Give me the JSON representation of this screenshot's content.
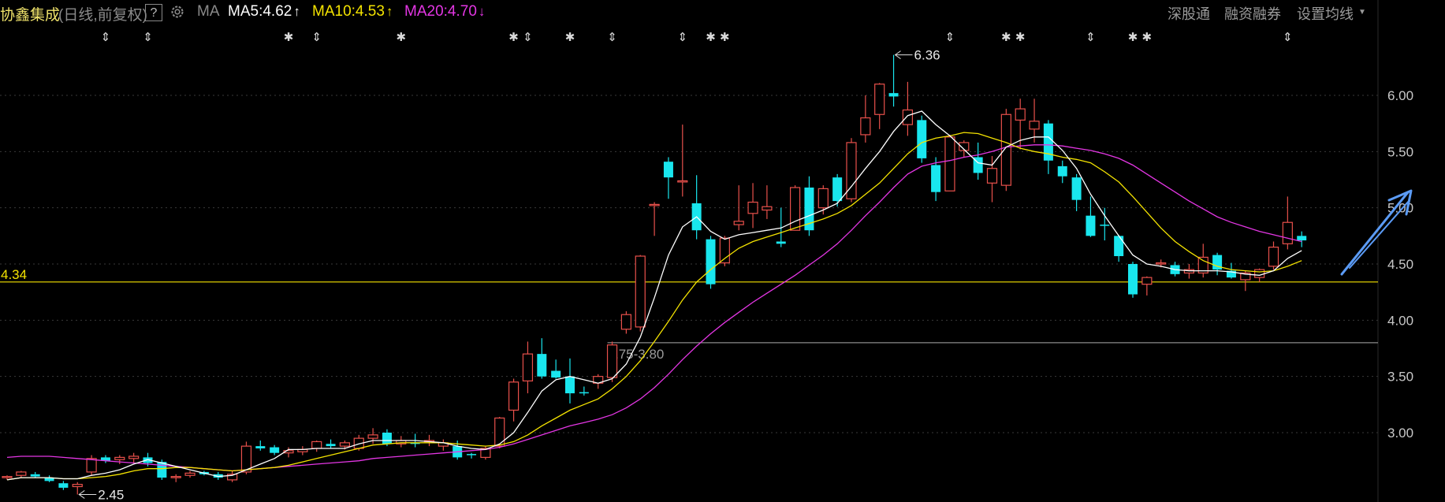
{
  "header": {
    "stock_name": "协鑫集成",
    "adj_mode": "(日线,前复权)",
    "help": "?",
    "ma_label": "MA",
    "ma5": "MA5:4.62",
    "ma10": "MA10:4.53",
    "ma20": "MA20:4.70",
    "up_arrow": "↑",
    "down_arrow": "↓",
    "nav": [
      "深股通",
      "融资融券",
      "设置均线"
    ],
    "caret": "▼"
  },
  "icons": {
    "settings": "gear-icon",
    "dropdown": "chevron-down-icon",
    "trend": "trend-arrow-icon",
    "event": "event-marker-icon"
  },
  "colors": {
    "up": "#e8504b",
    "down": "#19e6ee",
    "ma5": "#ffffff",
    "ma10": "#f4e300",
    "ma20": "#e436e4",
    "hline": "#f4e300",
    "range_line": "#8a8a8a",
    "trend_arrow": "#5b9bf5",
    "bg": "#000000"
  },
  "chart_data": {
    "type": "candlestick",
    "ylim": [
      2.4,
      6.7
    ],
    "y_ticks": [
      "6.00",
      "5.50",
      "5.00",
      "4.50",
      "4.00",
      "3.50",
      "3.00"
    ],
    "y_tick_values": [
      6.0,
      5.5,
      5.0,
      4.5,
      4.0,
      3.5,
      3.0
    ],
    "grid": true,
    "candles": [
      [
        2.6,
        2.62,
        2.58,
        2.61
      ],
      [
        2.62,
        2.66,
        2.6,
        2.65
      ],
      [
        2.63,
        2.65,
        2.6,
        2.61
      ],
      [
        2.6,
        2.62,
        2.56,
        2.57
      ],
      [
        2.55,
        2.57,
        2.49,
        2.51
      ],
      [
        2.52,
        2.56,
        2.45,
        2.54
      ],
      [
        2.65,
        2.8,
        2.62,
        2.77
      ],
      [
        2.78,
        2.8,
        2.73,
        2.75
      ],
      [
        2.76,
        2.8,
        2.72,
        2.78
      ],
      [
        2.77,
        2.82,
        2.73,
        2.79
      ],
      [
        2.78,
        2.82,
        2.7,
        2.73
      ],
      [
        2.74,
        2.76,
        2.58,
        2.6
      ],
      [
        2.6,
        2.63,
        2.56,
        2.61
      ],
      [
        2.62,
        2.66,
        2.6,
        2.64
      ],
      [
        2.65,
        2.66,
        2.62,
        2.63
      ],
      [
        2.63,
        2.65,
        2.58,
        2.6
      ],
      [
        2.58,
        2.66,
        2.56,
        2.63
      ],
      [
        2.65,
        2.92,
        2.63,
        2.88
      ],
      [
        2.88,
        2.93,
        2.84,
        2.86
      ],
      [
        2.87,
        2.89,
        2.8,
        2.82
      ],
      [
        2.82,
        2.87,
        2.78,
        2.84
      ],
      [
        2.83,
        2.88,
        2.8,
        2.85
      ],
      [
        2.86,
        2.93,
        2.83,
        2.92
      ],
      [
        2.9,
        2.94,
        2.86,
        2.88
      ],
      [
        2.88,
        2.93,
        2.85,
        2.91
      ],
      [
        2.86,
        2.98,
        2.84,
        2.95
      ],
      [
        2.95,
        3.04,
        2.9,
        2.98
      ],
      [
        3.0,
        3.03,
        2.88,
        2.9
      ],
      [
        2.9,
        2.97,
        2.87,
        2.93
      ],
      [
        2.91,
        2.99,
        2.87,
        2.9
      ],
      [
        2.92,
        2.98,
        2.88,
        2.93
      ],
      [
        2.88,
        2.94,
        2.84,
        2.91
      ],
      [
        2.88,
        2.93,
        2.76,
        2.78
      ],
      [
        2.81,
        2.82,
        2.77,
        2.8
      ],
      [
        2.78,
        2.88,
        2.76,
        2.86
      ],
      [
        2.88,
        3.14,
        2.86,
        3.13
      ],
      [
        3.2,
        3.48,
        3.1,
        3.45
      ],
      [
        3.46,
        3.81,
        3.35,
        3.7
      ],
      [
        3.7,
        3.84,
        3.48,
        3.5
      ],
      [
        3.55,
        3.65,
        3.48,
        3.49
      ],
      [
        3.5,
        3.66,
        3.26,
        3.35
      ],
      [
        3.36,
        3.41,
        3.33,
        3.35
      ],
      [
        3.44,
        3.52,
        3.39,
        3.5
      ],
      [
        3.49,
        3.81,
        3.45,
        3.78
      ],
      [
        3.92,
        4.08,
        3.88,
        4.05
      ],
      [
        3.94,
        4.58,
        3.9,
        4.57
      ],
      [
        5.02,
        5.05,
        4.75,
        5.03
      ],
      [
        5.41,
        5.45,
        5.08,
        5.27
      ],
      [
        5.24,
        5.74,
        5.1,
        5.24
      ],
      [
        5.04,
        5.29,
        4.72,
        4.8
      ],
      [
        4.72,
        4.75,
        4.28,
        4.32
      ],
      [
        4.51,
        4.75,
        4.48,
        4.73
      ],
      [
        4.85,
        5.2,
        4.8,
        4.88
      ],
      [
        4.95,
        5.22,
        4.82,
        5.05
      ],
      [
        4.98,
        5.2,
        4.9,
        5.01
      ],
      [
        4.7,
        5.0,
        4.65,
        4.68
      ],
      [
        4.8,
        5.2,
        4.8,
        5.18
      ],
      [
        5.18,
        5.28,
        4.75,
        4.8
      ],
      [
        5.0,
        5.2,
        4.94,
        5.17
      ],
      [
        5.27,
        5.3,
        5.01,
        5.06
      ],
      [
        5.08,
        5.62,
        5.05,
        5.58
      ],
      [
        5.65,
        6.0,
        5.58,
        5.8
      ],
      [
        5.83,
        6.11,
        5.7,
        6.1
      ],
      [
        6.02,
        6.36,
        5.9,
        5.99
      ],
      [
        5.74,
        6.12,
        5.64,
        5.87
      ],
      [
        5.78,
        5.82,
        5.4,
        5.44
      ],
      [
        5.38,
        5.45,
        5.06,
        5.14
      ],
      [
        5.15,
        5.65,
        5.15,
        5.63
      ],
      [
        5.51,
        5.6,
        5.45,
        5.58
      ],
      [
        5.45,
        5.58,
        5.25,
        5.31
      ],
      [
        5.22,
        5.46,
        5.05,
        5.35
      ],
      [
        5.2,
        5.88,
        5.15,
        5.83
      ],
      [
        5.78,
        5.97,
        5.52,
        5.88
      ],
      [
        5.7,
        5.97,
        5.58,
        5.77
      ],
      [
        5.75,
        5.78,
        5.3,
        5.42
      ],
      [
        5.37,
        5.42,
        5.22,
        5.28
      ],
      [
        5.27,
        5.3,
        4.97,
        5.07
      ],
      [
        4.93,
        5.1,
        4.74,
        4.75
      ],
      [
        4.85,
        5.0,
        4.71,
        4.84
      ],
      [
        4.75,
        4.76,
        4.52,
        4.57
      ],
      [
        4.5,
        4.52,
        4.2,
        4.23
      ],
      [
        4.32,
        4.39,
        4.22,
        4.38
      ],
      [
        4.5,
        4.54,
        4.47,
        4.51
      ],
      [
        4.49,
        4.52,
        4.39,
        4.41
      ],
      [
        4.42,
        4.5,
        4.37,
        4.45
      ],
      [
        4.42,
        4.68,
        4.38,
        4.56
      ],
      [
        4.58,
        4.6,
        4.4,
        4.45
      ],
      [
        4.44,
        4.51,
        4.37,
        4.38
      ],
      [
        4.36,
        4.44,
        4.26,
        4.42
      ],
      [
        4.38,
        4.46,
        4.34,
        4.45
      ],
      [
        4.48,
        4.7,
        4.45,
        4.65
      ],
      [
        4.68,
        5.1,
        4.63,
        4.87
      ],
      [
        4.75,
        4.79,
        4.65,
        4.71
      ]
    ],
    "ma5": [
      2.58,
      2.6,
      2.6,
      2.6,
      2.59,
      2.59,
      2.62,
      2.64,
      2.67,
      2.72,
      2.76,
      2.73,
      2.7,
      2.67,
      2.64,
      2.61,
      2.62,
      2.67,
      2.72,
      2.77,
      2.85,
      2.85,
      2.86,
      2.86,
      2.86,
      2.9,
      2.93,
      2.93,
      2.93,
      2.93,
      2.92,
      2.91,
      2.88,
      2.86,
      2.85,
      2.9,
      3.0,
      3.18,
      3.37,
      3.47,
      3.5,
      3.47,
      3.44,
      3.48,
      3.61,
      3.85,
      4.2,
      4.58,
      4.83,
      4.92,
      4.79,
      4.72,
      4.76,
      4.78,
      4.8,
      4.82,
      4.88,
      4.93,
      4.98,
      5.04,
      5.19,
      5.35,
      5.5,
      5.68,
      5.82,
      5.86,
      5.74,
      5.64,
      5.52,
      5.4,
      5.38,
      5.54,
      5.6,
      5.63,
      5.63,
      5.51,
      5.35,
      5.12,
      4.93,
      4.75,
      4.58,
      4.5,
      4.48,
      4.45,
      4.44,
      4.44,
      4.44,
      4.43,
      4.41,
      4.4,
      4.44,
      4.55,
      4.62
    ],
    "ma10": [
      2.58,
      2.6,
      2.6,
      2.6,
      2.59,
      2.59,
      2.6,
      2.61,
      2.63,
      2.66,
      2.68,
      2.68,
      2.69,
      2.69,
      2.68,
      2.67,
      2.66,
      2.67,
      2.68,
      2.69,
      2.71,
      2.74,
      2.77,
      2.8,
      2.83,
      2.86,
      2.89,
      2.9,
      2.91,
      2.91,
      2.91,
      2.91,
      2.9,
      2.89,
      2.88,
      2.89,
      2.92,
      2.98,
      3.06,
      3.13,
      3.2,
      3.25,
      3.3,
      3.39,
      3.5,
      3.64,
      3.81,
      3.99,
      4.18,
      4.34,
      4.45,
      4.55,
      4.64,
      4.7,
      4.74,
      4.78,
      4.82,
      4.86,
      4.9,
      4.95,
      5.02,
      5.12,
      5.22,
      5.35,
      5.48,
      5.58,
      5.62,
      5.64,
      5.67,
      5.66,
      5.62,
      5.58,
      5.53,
      5.5,
      5.48,
      5.45,
      5.43,
      5.4,
      5.32,
      5.23,
      5.1,
      4.96,
      4.82,
      4.7,
      4.61,
      4.53,
      4.48,
      4.45,
      4.44,
      4.43,
      4.44,
      4.48,
      4.53
    ],
    "ma20": [
      2.78,
      2.79,
      2.79,
      2.79,
      2.78,
      2.77,
      2.76,
      2.75,
      2.74,
      2.73,
      2.72,
      2.71,
      2.7,
      2.69,
      2.68,
      2.67,
      2.66,
      2.67,
      2.68,
      2.69,
      2.7,
      2.71,
      2.72,
      2.73,
      2.74,
      2.75,
      2.77,
      2.78,
      2.79,
      2.8,
      2.81,
      2.82,
      2.83,
      2.84,
      2.85,
      2.87,
      2.9,
      2.94,
      2.98,
      3.02,
      3.06,
      3.09,
      3.12,
      3.16,
      3.22,
      3.3,
      3.4,
      3.52,
      3.65,
      3.77,
      3.88,
      3.98,
      4.07,
      4.16,
      4.24,
      4.32,
      4.4,
      4.49,
      4.58,
      4.68,
      4.8,
      4.93,
      5.05,
      5.18,
      5.3,
      5.37,
      5.4,
      5.42,
      5.45,
      5.47,
      5.5,
      5.54,
      5.55,
      5.56,
      5.56,
      5.55,
      5.53,
      5.51,
      5.48,
      5.44,
      5.38,
      5.3,
      5.22,
      5.14,
      5.06,
      4.99,
      4.92,
      4.87,
      4.83,
      4.79,
      4.76,
      4.73,
      4.7
    ],
    "ma_start_index": 0,
    "hline": {
      "value": 4.34,
      "label": "4.34"
    },
    "range_line": {
      "value": 3.8,
      "from_index": 43,
      "label": "3.75-3.80"
    },
    "max_label": {
      "index": 63,
      "value": 6.36,
      "label": "6.36"
    },
    "min_label": {
      "index": 5,
      "value": 2.45,
      "label": "2.45"
    },
    "markers": [
      {
        "index": 7,
        "glyph": "⇕"
      },
      {
        "index": 10,
        "glyph": "⇕"
      },
      {
        "index": 20,
        "glyph": "✱"
      },
      {
        "index": 22,
        "glyph": "⇕"
      },
      {
        "index": 28,
        "glyph": "✱"
      },
      {
        "index": 36,
        "glyph": "✱"
      },
      {
        "index": 37,
        "glyph": "⇕"
      },
      {
        "index": 40,
        "glyph": "✱"
      },
      {
        "index": 43,
        "glyph": "⇕"
      },
      {
        "index": 48,
        "glyph": "⇕"
      },
      {
        "index": 50,
        "glyph": "✱"
      },
      {
        "index": 51,
        "glyph": "✱"
      },
      {
        "index": 67,
        "glyph": "⇕"
      },
      {
        "index": 71,
        "glyph": "✱"
      },
      {
        "index": 72,
        "glyph": "✱"
      },
      {
        "index": 77,
        "glyph": "⇕"
      },
      {
        "index": 80,
        "glyph": "✱"
      },
      {
        "index": 81,
        "glyph": "✱"
      },
      {
        "index": 91,
        "glyph": "⇕"
      }
    ]
  }
}
